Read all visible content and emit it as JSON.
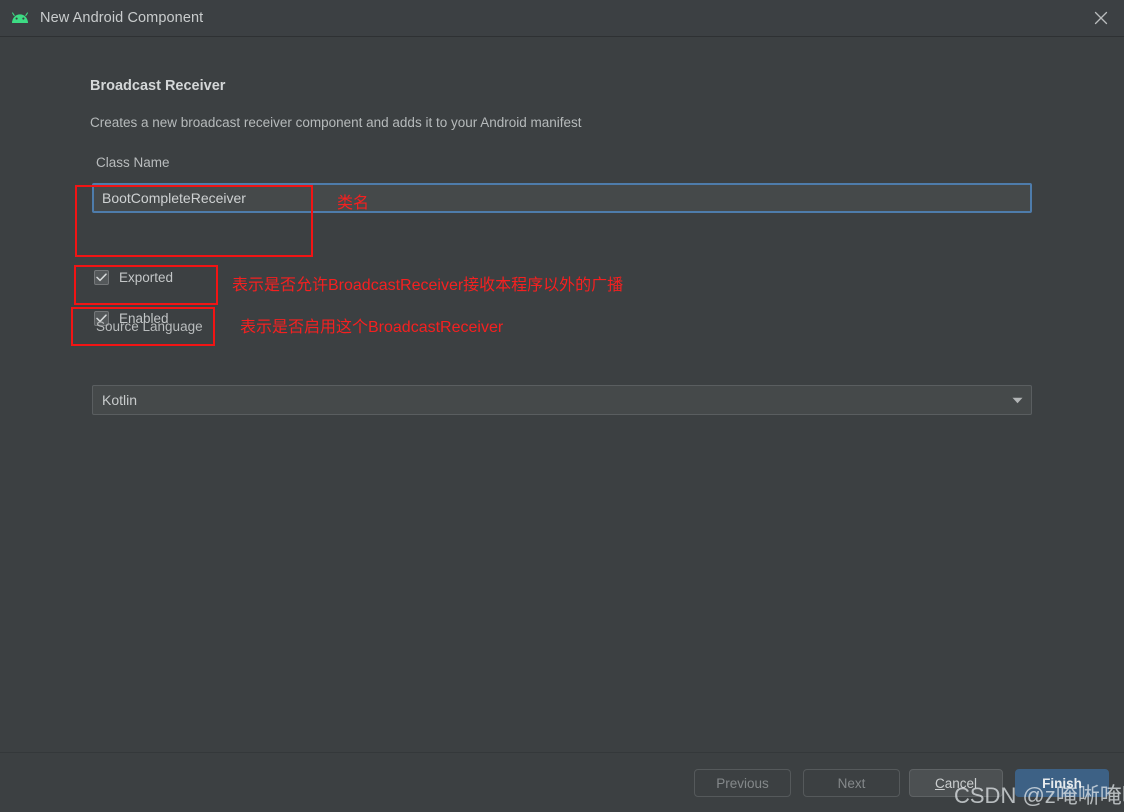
{
  "window": {
    "title": "New Android Component",
    "icon": "android-icon",
    "close_icon": "close-icon"
  },
  "page": {
    "heading": "Broadcast Receiver",
    "subheading": "Creates a new broadcast receiver component and adds it to your Android manifest"
  },
  "form": {
    "class_name": {
      "label": "Class Name",
      "value": "BootCompleteReceiver"
    },
    "exported": {
      "label": "Exported",
      "checked": true
    },
    "enabled": {
      "label": "Enabled",
      "checked": true
    },
    "source_language": {
      "label": "Source Language",
      "value": "Kotlin",
      "arrow_icon": "chevron-down-icon"
    }
  },
  "annotations": {
    "class_name": "类名",
    "exported": "表示是否允许BroadcastReceiver接收本程序以外的广播",
    "enabled": "表示是否启用这个BroadcastReceiver",
    "color": "#f52020"
  },
  "footer": {
    "previous": "Previous",
    "next": "Next",
    "cancel_mnemonic": "C",
    "cancel_rest": "ancel",
    "finish": "Finish"
  },
  "watermark": {
    "text": "CSDN @z唵唽唵唽"
  }
}
